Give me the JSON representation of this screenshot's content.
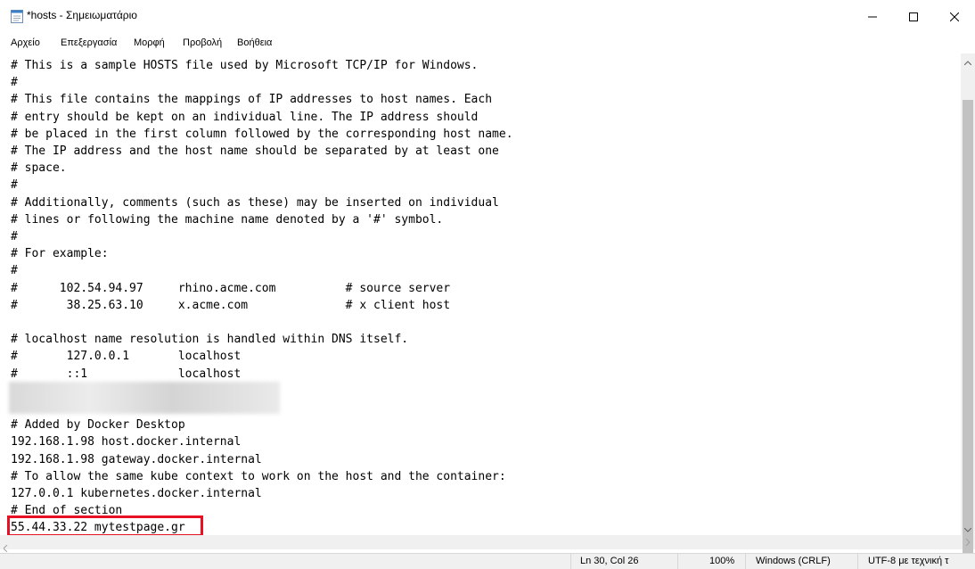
{
  "window": {
    "title": "*hosts - Σημειωματάριο",
    "icons": {
      "app": "notepad-icon",
      "minimize": "minimize-icon",
      "maximize": "maximize-icon",
      "close": "close-icon"
    }
  },
  "menu": [
    {
      "label": "Αρχείο"
    },
    {
      "label": "Επεξεργασία"
    },
    {
      "label": "Μορφή"
    },
    {
      "label": "Προβολή"
    },
    {
      "label": "Βοήθεια"
    }
  ],
  "editor": {
    "content": "# This is a sample HOSTS file used by Microsoft TCP/IP for Windows.\n#\n# This file contains the mappings of IP addresses to host names. Each\n# entry should be kept on an individual line. The IP address should\n# be placed in the first column followed by the corresponding host name.\n# The IP address and the host name should be separated by at least one\n# space.\n#\n# Additionally, comments (such as these) may be inserted on individual\n# lines or following the machine name denoted by a '#' symbol.\n#\n# For example:\n#\n#      102.54.94.97     rhino.acme.com          # source server\n#       38.25.63.10     x.acme.com              # x client host\n\n# localhost name resolution is handled within DNS itself.\n#\t127.0.0.1       localhost\n#\t::1             localhost\n\n\n# Added by Docker Desktop\n192.168.1.98 host.docker.internal\n192.168.1.98 gateway.docker.internal\n# To allow the same kube context to work on the host and the container:\n127.0.0.1 kubernetes.docker.internal\n# End of section\n55.44.33.22 mytestpage.gr",
    "highlighted_line": "55.44.33.22 mytestpage.gr"
  },
  "status": {
    "position": "Ln 30, Col 26",
    "zoom": "100%",
    "line_ending": "Windows (CRLF)",
    "encoding": "UTF-8 με τεχνική τ"
  },
  "colors": {
    "highlight_border": "#e81123",
    "statusbar_bg": "#f0f0f0",
    "scroll_thumb": "#c2c2c2"
  }
}
